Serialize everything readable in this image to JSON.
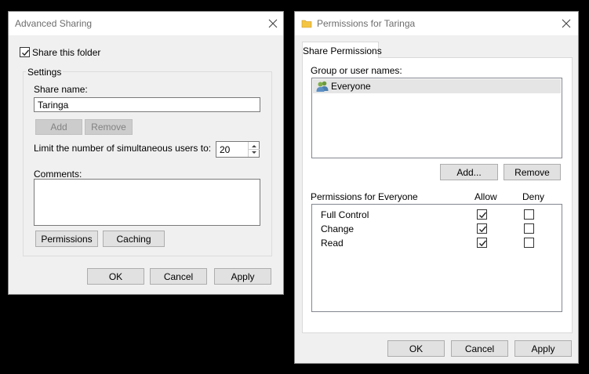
{
  "advanced_sharing": {
    "title": "Advanced Sharing",
    "share_checkbox_label": "Share this folder",
    "share_checked": true,
    "settings_group_label": "Settings",
    "share_name_label": "Share name:",
    "share_name_value": "Taringa",
    "add_label": "Add",
    "remove_label": "Remove",
    "limit_label": "Limit the number of simultaneous users to:",
    "limit_value": "20",
    "comments_label": "Comments:",
    "comments_value": "",
    "permissions_label": "Permissions",
    "caching_label": "Caching",
    "ok_label": "OK",
    "cancel_label": "Cancel",
    "apply_label": "Apply"
  },
  "permissions_dialog": {
    "title": "Permissions for Taringa",
    "tab_label": "Share Permissions",
    "group_label": "Group or user names:",
    "users": [
      {
        "name": "Everyone",
        "icon": "users-icon"
      }
    ],
    "add_label": "Add...",
    "remove_label": "Remove",
    "perm_header": "Permissions for Everyone",
    "allow_header": "Allow",
    "deny_header": "Deny",
    "permissions": [
      {
        "name": "Full Control",
        "allow": true,
        "deny": false
      },
      {
        "name": "Change",
        "allow": true,
        "deny": false
      },
      {
        "name": "Read",
        "allow": true,
        "deny": false
      }
    ],
    "ok_label": "OK",
    "cancel_label": "Cancel",
    "apply_label": "Apply"
  },
  "colors": {
    "titlebar": "#ffffff",
    "window_bg": "#f0f0f0",
    "selection": "#e5e5e5",
    "folder": "#f4c542"
  }
}
